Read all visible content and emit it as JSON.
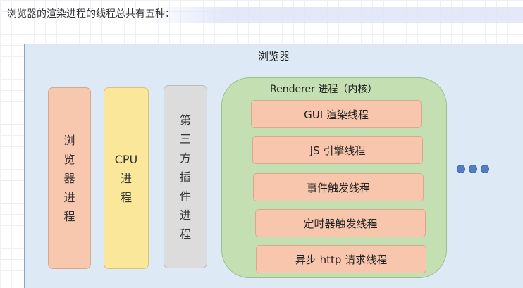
{
  "intro_text": "浏览器的渲染进程的线程总共有五种：",
  "diagram": {
    "title": "浏览器",
    "processes": [
      {
        "name": "browser-process",
        "chars": [
          "浏",
          "览",
          "器",
          "进",
          "程"
        ]
      },
      {
        "name": "cpu-process",
        "chars": [
          "CPU",
          "进",
          "程"
        ]
      },
      {
        "name": "plugin-process",
        "chars": [
          "第",
          "三",
          "方",
          "插",
          "件",
          "进",
          "程"
        ]
      }
    ],
    "renderer": {
      "title": "Renderer 进程（内核）",
      "threads": [
        "GUI 渲染线程",
        "JS 引擎线程",
        "事件触发线程",
        "定时器触发线程",
        "异步 http 请求线程"
      ]
    }
  },
  "colors": {
    "frame_bg": "#dde9f5",
    "browser_process": "#f7c7ae",
    "cpu_process": "#fbe79a",
    "plugin_process": "#dcdcdc",
    "renderer_bg": "#c4dfb2",
    "thread_bg": "#f7c6ad",
    "dots": "#4f7fc4"
  },
  "icons": {
    "ellipsis": "more-dots-icon"
  }
}
